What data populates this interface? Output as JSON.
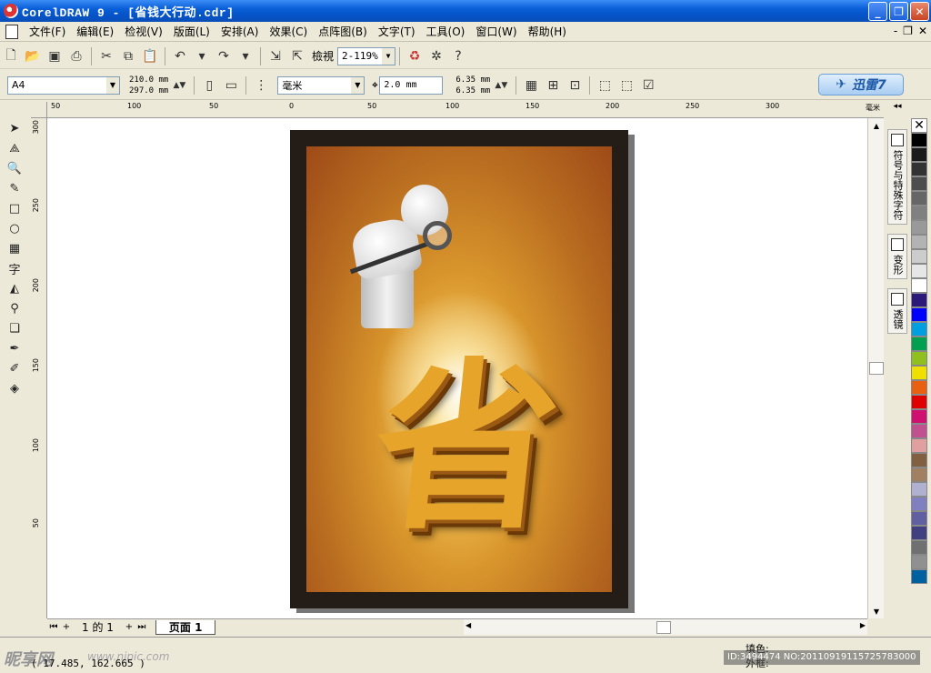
{
  "titlebar": {
    "title": "CorelDRAW 9 - [省钱大行动.cdr]",
    "minimize": "_",
    "restore": "❐",
    "close": "✕"
  },
  "menubar": {
    "items": [
      "文件(F)",
      "编辑(E)",
      "检视(V)",
      "版面(L)",
      "安排(A)",
      "效果(C)",
      "点阵图(B)",
      "文字(T)",
      "工具(O)",
      "窗口(W)",
      "帮助(H)"
    ],
    "mdi": [
      "-",
      "❐",
      "✕"
    ]
  },
  "toolbar1": {
    "zoom_label": "檢視",
    "zoom_value": "2-119%"
  },
  "toolbar2": {
    "paper_size": "A4",
    "width": "210.0 mm",
    "height": "297.0 mm",
    "units": "毫米",
    "nudge": "2.0 mm",
    "dup_x": "6.35 mm",
    "dup_y": "6.35 mm",
    "xunlei_label": "迅雷7"
  },
  "ruler": {
    "unit": "毫米",
    "h_ticks": [
      "50",
      "100",
      "50",
      "0",
      "50",
      "100",
      "150",
      "200",
      "250",
      "300"
    ],
    "v_ticks": [
      "300",
      "250",
      "200",
      "150",
      "100",
      "50"
    ]
  },
  "poster": {
    "main_char": "省"
  },
  "dockers": {
    "tabs": [
      "符号与特殊字符",
      "变形",
      "透镜"
    ]
  },
  "palette": {
    "colors": [
      "#000000",
      "#1a1a1a",
      "#333333",
      "#4d4d4d",
      "#666666",
      "#808080",
      "#999999",
      "#b3b3b3",
      "#cccccc",
      "#e6e6e6",
      "#ffffff",
      "#2b1a7a",
      "#0000ff",
      "#00a0e0",
      "#00a050",
      "#90c020",
      "#f0e000",
      "#e86010",
      "#e00000",
      "#d01070",
      "#c05090",
      "#e0a0a0",
      "#806040",
      "#a08060",
      "#b0b0d0",
      "#8080c0",
      "#6060a0",
      "#404080",
      "#707070",
      "#909090",
      "#0060a0"
    ]
  },
  "pagebar": {
    "count": "1 的 1",
    "page_tab": "页面 1"
  },
  "statusbar": {
    "coords": "( 17.485, 162.665 )",
    "fill_label": "填色:",
    "outline_label": "外框:",
    "watermark": "昵享网",
    "watermark_url": "www.nipic.com",
    "image_id": "ID:3494474 NO:20110919115725783000"
  }
}
